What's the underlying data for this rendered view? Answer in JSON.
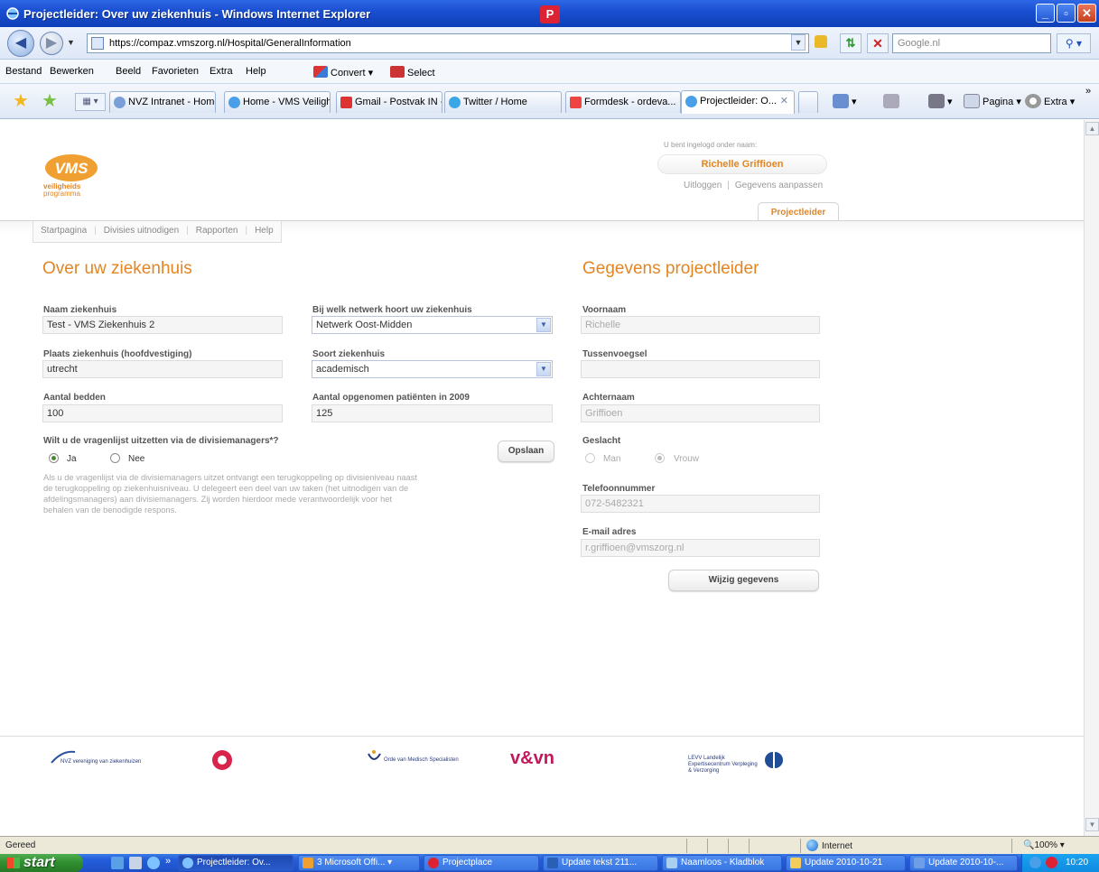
{
  "window": {
    "title": "Projectleider: Over uw ziekenhuis - Windows Internet Explorer",
    "badge": "P",
    "min": "_",
    "max": "▫",
    "close": "✕"
  },
  "addressbar": {
    "url": "https://compaz.vmszorg.nl/Hospital/GeneralInformation",
    "search_placeholder": "Google.nl"
  },
  "menubar": {
    "items": [
      "Bestand",
      "Bewerken",
      "Beeld",
      "Favorieten",
      "Extra",
      "Help"
    ],
    "convert": "Convert",
    "select": "Select"
  },
  "tabs": [
    "NVZ Intranet - Home",
    "Home - VMS Veiligh...",
    "Gmail - Postvak IN -...",
    "Twitter / Home",
    "Formdesk - ordeva...",
    "Projectleider: O..."
  ],
  "commandbar": {
    "page": "Pagina",
    "tools": "Extra"
  },
  "site": {
    "logo_word": "VMS",
    "logo_line1": "veiligheids",
    "logo_line2": "programma",
    "login_label": "U bent ingelogd onder naam:",
    "username": "Richelle Griffioen",
    "logout": "Uitloggen",
    "sep": "|",
    "edit_profile": "Gegevens aanpassen",
    "role_tab": "Projectleider",
    "nav": [
      "Startpagina",
      "Divisies uitnodigen",
      "Rapporten",
      "Help"
    ]
  },
  "hospital": {
    "title": "Over uw ziekenhuis",
    "name_label": "Naam ziekenhuis",
    "name_value": "Test - VMS Ziekenhuis 2",
    "place_label": "Plaats ziekenhuis (hoofdvestiging)",
    "place_value": "utrecht",
    "beds_label": "Aantal bedden",
    "beds_value": "100",
    "network_label": "Bij welk netwerk hoort uw ziekenhuis",
    "network_value": "Netwerk Oost-Midden",
    "type_label": "Soort ziekenhuis",
    "type_value": "academisch",
    "patients_label": "Aantal opgenomen patiënten in 2009",
    "patients_value": "125",
    "question": "Wilt u de vragenlijst uitzetten via de divisiemanagers*?",
    "yes": "Ja",
    "no": "Nee",
    "note": "Als u de vragenlijst via de divisiemanagers uitzet ontvangt een terugkoppeling op divisieniveau naast de terugkoppeling op ziekenhuisniveau. U delegeert een deel van uw taken (het uitnodigen van de afdelingsmanagers) aan divisiemanagers. Zij worden hierdoor mede verantwoordelijk voor het behalen van de benodigde respons.",
    "save": "Opslaan"
  },
  "leader": {
    "title": "Gegevens projectleider",
    "first_label": "Voornaam",
    "first_value": "Richelle",
    "infix_label": "Tussenvoegsel",
    "infix_value": "",
    "last_label": "Achternaam",
    "last_value": "Griffioen",
    "gender_label": "Geslacht",
    "male": "Man",
    "female": "Vrouw",
    "phone_label": "Telefoonnummer",
    "phone_value": "072-5482321",
    "email_label": "E-mail adres",
    "email_value": "r.griffioen@vmszorg.nl",
    "edit": "Wijzig gegevens"
  },
  "footer": {
    "nvz": "NVZ vereniging van ziekenhuizen",
    "ovms": "Orde van Medisch Specialisten",
    "vvn": "v&vn",
    "levv": "LEVV Landelijk Expertisecentrum Verpleging & Verzorging"
  },
  "statusbar": {
    "status": "Gereed",
    "zone": "Internet",
    "zoom": "100%"
  },
  "taskbar": {
    "start": "start",
    "items": [
      "Projectleider: Ov...",
      "3 Microsoft Offi...",
      "Projectplace",
      "Update tekst 211...",
      "Naamloos - Kladblok",
      "Update 2010-10-21",
      "Update 2010-10-..."
    ],
    "clock": "10:20"
  },
  "colors": {
    "accent": "#e38522",
    "xp_blue": "#245edb"
  }
}
